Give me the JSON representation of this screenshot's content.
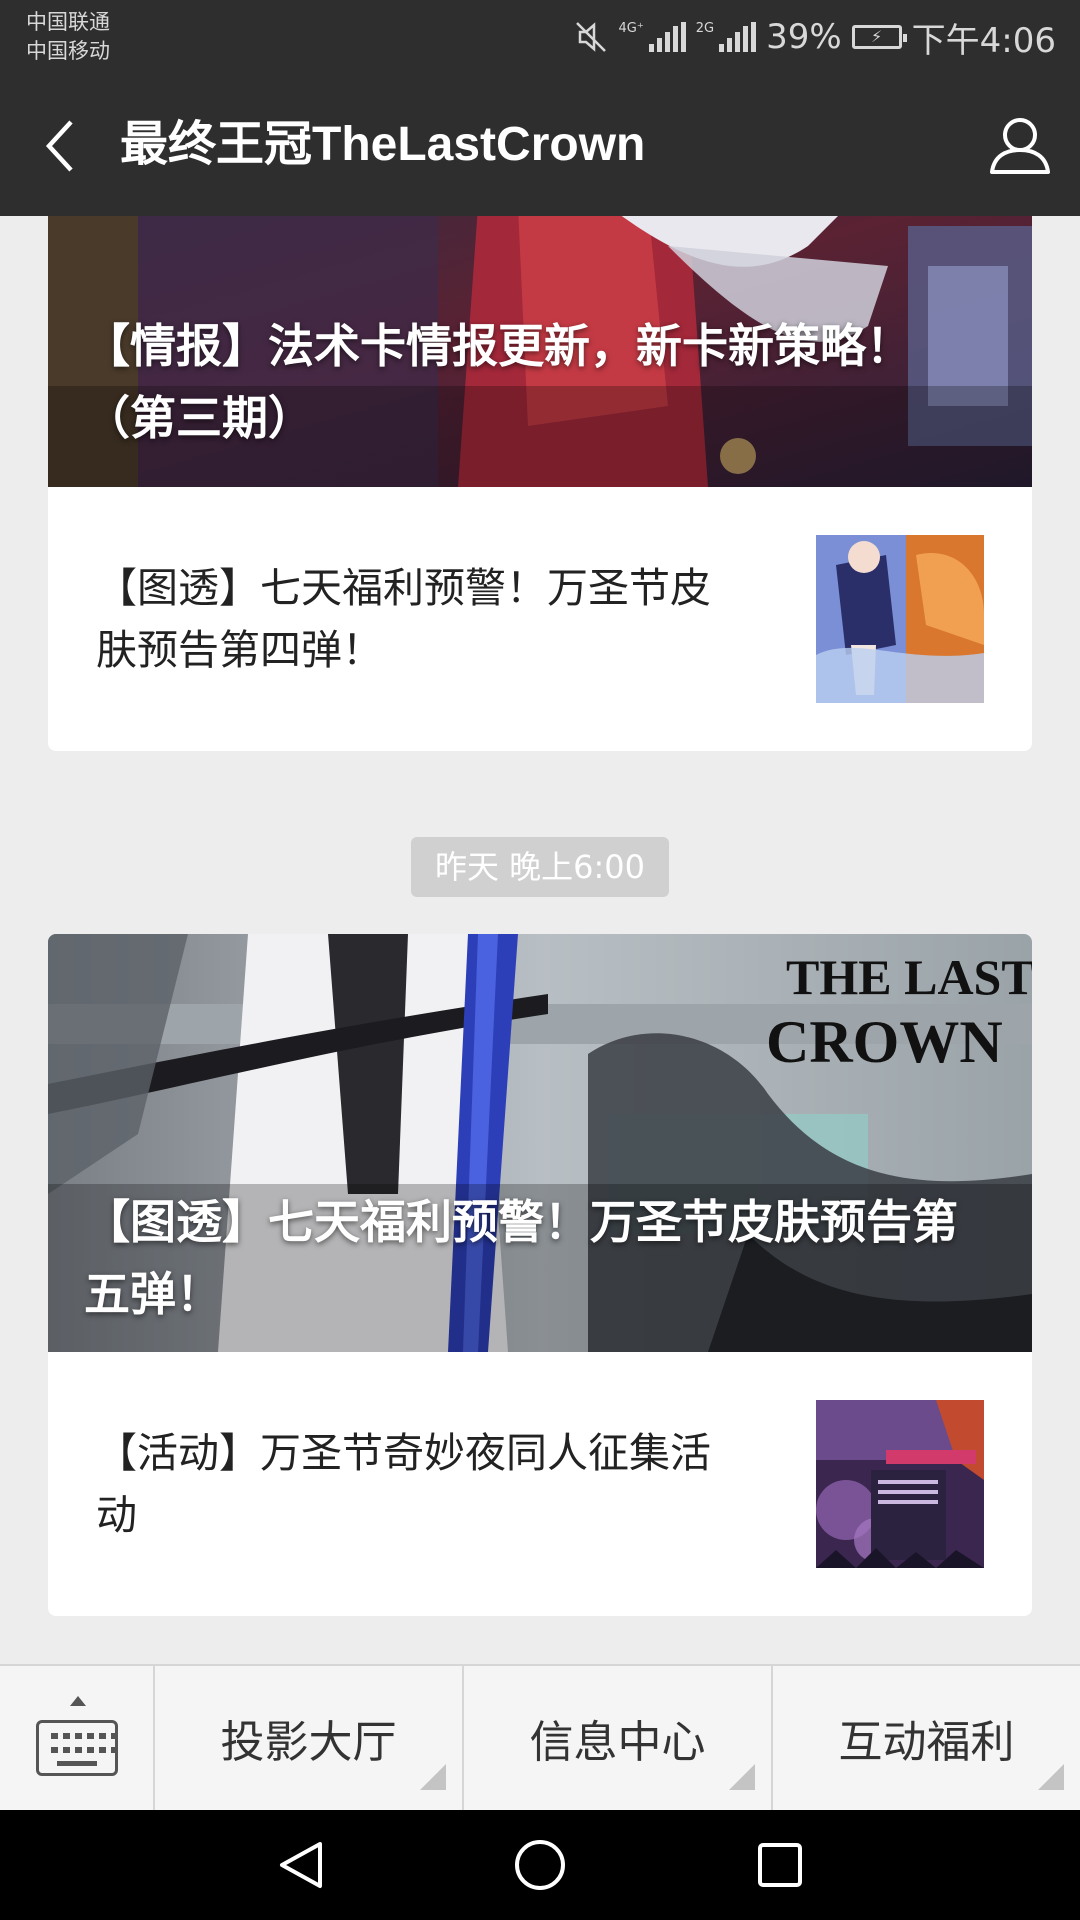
{
  "status_bar": {
    "carrier_1": "中国联通",
    "carrier_2": "中国移动",
    "network_1": "4G⁺",
    "network_2": "2G",
    "battery": "39%",
    "time": "下午4:06",
    "icons": [
      "mute-icon",
      "signal-icon",
      "battery-icon"
    ]
  },
  "header": {
    "title": "最终王冠TheLastCrown",
    "icons": [
      "back-arrow-icon",
      "profile-icon"
    ]
  },
  "feed": {
    "card_1": {
      "cover_title": "【情报】法术卡情报更新，新卡新策略！（第三期）",
      "sub_item_title": "【图透】七天福利预警！万圣节皮肤预告第四弹！"
    },
    "timestamp": "昨天 晚上6:00",
    "card_2": {
      "cover_title": "【图透】七天福利预警！万圣节皮肤预告第五弹！",
      "cover_logo_line_1": "THE LAST",
      "cover_logo_line_2": "CROWN",
      "sub_item_title": "【活动】万圣节奇妙夜同人征集活动"
    }
  },
  "bottom_menu": {
    "items": [
      "投影大厅",
      "信息中心",
      "互动福利"
    ],
    "icons": [
      "keyboard-icon"
    ]
  },
  "nav_bar": {
    "icons": [
      "back-triangle-icon",
      "home-circle-icon",
      "recents-square-icon"
    ]
  },
  "colors": {
    "header_bg": "#2e2e2e",
    "page_bg": "#ededed",
    "card_bg": "#ffffff",
    "timestamp_bg": "#d0d0d0",
    "menu_bg": "#f5f5f5"
  }
}
